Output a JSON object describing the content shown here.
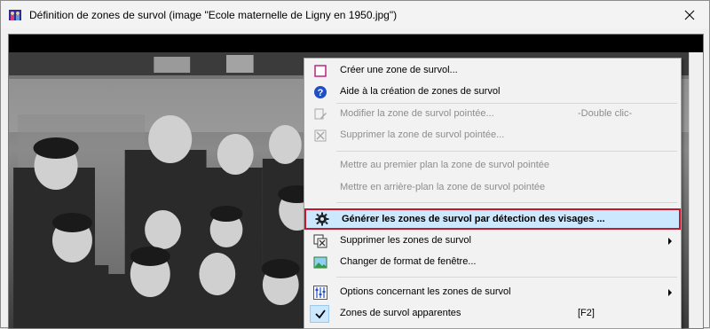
{
  "window": {
    "title": "Définition de zones de survol (image \"Ecole maternelle de Ligny en 1950.jpg\")",
    "icon": "app-icon"
  },
  "menu": {
    "items": [
      {
        "label": "Créer une zone de survol...",
        "icon": "square-outline-icon",
        "enabled": true
      },
      {
        "label": "Aide à la création de zones de survol",
        "icon": "help-icon",
        "enabled": true
      },
      {
        "label": "Modifier la zone de survol pointée...",
        "shortcut": "-Double clic-",
        "icon": "edit-zone-icon",
        "enabled": false
      },
      {
        "label": "Supprimer la zone de survol pointée...",
        "icon": "delete-zone-icon",
        "enabled": false
      },
      {
        "label": "Mettre au premier plan la zone de survol pointée",
        "enabled": false
      },
      {
        "label": "Mettre en arrière-plan la zone de survol pointée",
        "enabled": false
      },
      {
        "label": "Générer les zones de survol par détection des visages ...",
        "icon": "gear-icon",
        "enabled": true,
        "highlighted": true
      },
      {
        "label": "Supprimer les zones de survol",
        "icon": "delete-zones-icon",
        "enabled": true,
        "submenu": true
      },
      {
        "label": "Changer de format de fenêtre...",
        "icon": "image-format-icon",
        "enabled": true
      },
      {
        "label": "Options concernant les zones de survol",
        "icon": "sliders-icon",
        "enabled": true,
        "submenu": true
      },
      {
        "label": "Zones de survol apparentes",
        "shortcut": "[F2]",
        "icon": "check-icon",
        "enabled": true,
        "checked": true
      }
    ]
  },
  "colors": {
    "highlight_bg": "#cce8ff",
    "highlight_border": "#c4182c",
    "disabled_text": "#8d8d8d"
  }
}
